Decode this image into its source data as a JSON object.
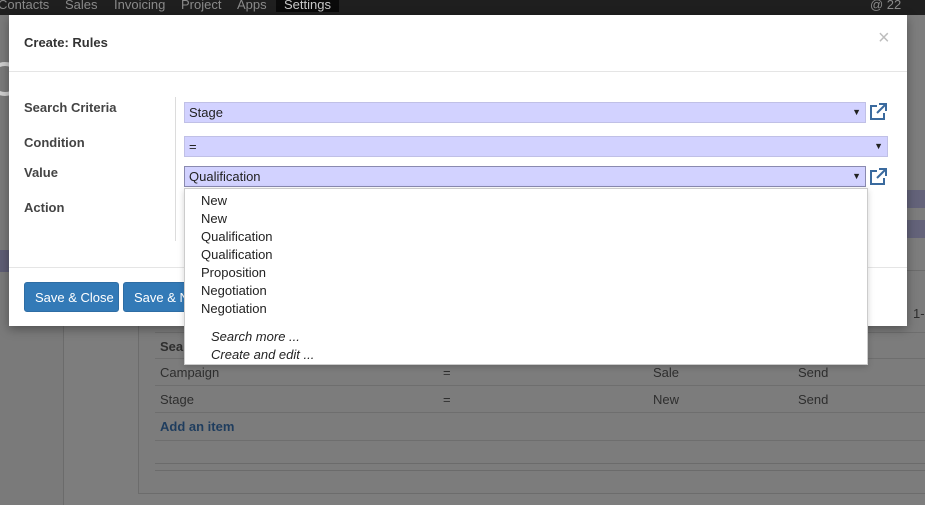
{
  "topnav": {
    "items": [
      "Contacts",
      "Sales",
      "Invoicing",
      "Project",
      "Apps",
      "Settings"
    ],
    "active": "Settings",
    "right": "@ 22"
  },
  "background": {
    "table_header": "Sea",
    "rows": [
      {
        "field": "Campaign",
        "condition": "=",
        "value": "Sale",
        "action": "Send"
      },
      {
        "field": "Stage",
        "condition": "=",
        "value": "New",
        "action": "Send"
      }
    ],
    "add_item": "Add an item",
    "pager": "1-"
  },
  "modal": {
    "title": "Create: Rules",
    "close": "×",
    "labels": {
      "search_criteria": "Search Criteria",
      "condition": "Condition",
      "value": "Value",
      "action": "Action"
    },
    "fields": {
      "search_criteria": "Stage",
      "condition": "=",
      "value": "Qualification"
    },
    "buttons": {
      "save_close": "Save & Close",
      "save_new": "Save & New"
    }
  },
  "dropdown": {
    "options": [
      "New",
      "New",
      "Qualification",
      "Qualification",
      "Proposition",
      "Negotiation",
      "Negotiation"
    ],
    "search_more": "Search more ...",
    "create_edit": "Create and edit ..."
  },
  "colors": {
    "primary": "#337ab7",
    "field_bg": "#d2d2ff",
    "topnav": "#1f1f1f"
  },
  "icons": {
    "external_link": "external-link-icon",
    "caret": "caret-down-icon",
    "close": "close-icon"
  }
}
